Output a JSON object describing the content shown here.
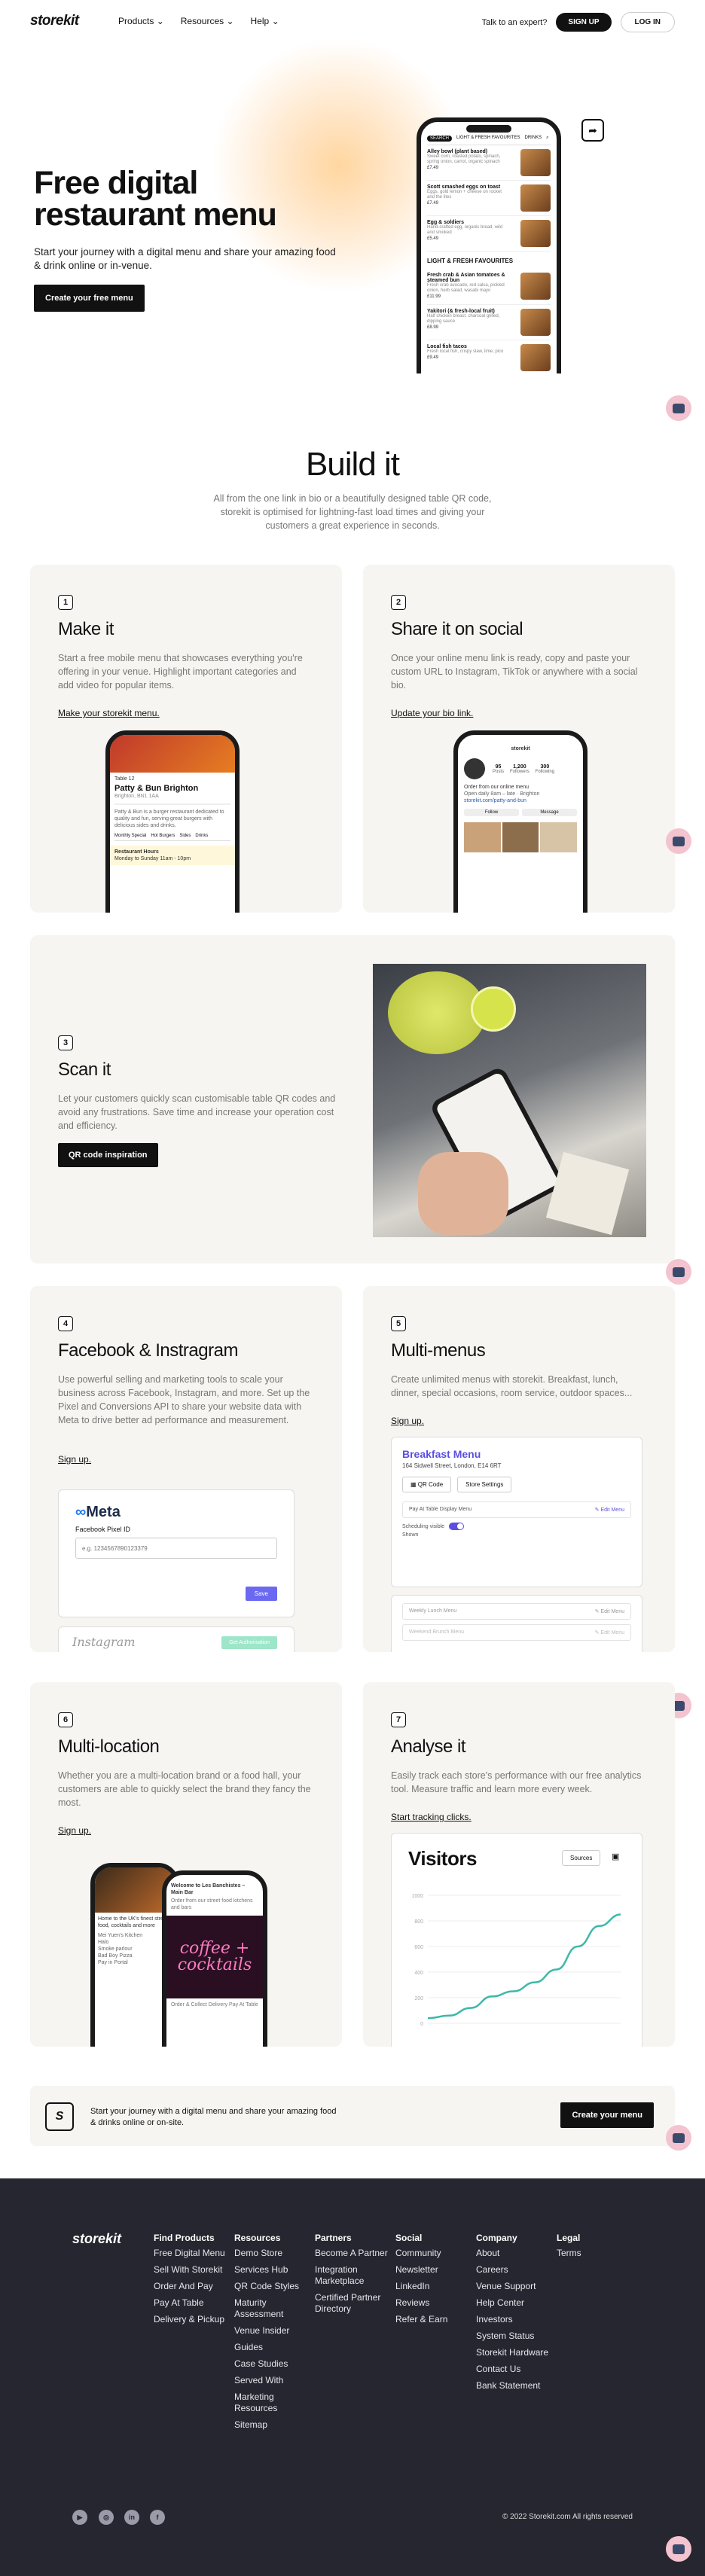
{
  "nav": {
    "logo": "storekit",
    "links": [
      "Products",
      "Resources",
      "Help"
    ],
    "expert": "Talk to an expert?",
    "signup": "SIGN UP",
    "login": "LOG IN"
  },
  "hero": {
    "title": "Free digital restaurant menu",
    "subtitle": "Start your journey with a digital menu and share your amazing food & drink online or in-venue.",
    "button": "Create your free menu",
    "phone": {
      "tabs": [
        "SEARCH",
        "LIGHT & FRESH FAVOURITES",
        "DRINKS"
      ],
      "items": [
        {
          "name": "Alley bowl (plant based)",
          "desc": "Sweet corn, roasted potato, spinach, spring onion, carrot, organic spinach",
          "price": "£7.49"
        },
        {
          "name": "Scott smashed eggs on toast",
          "desc": "Eggs, gold lemon + cheese on rocket and the lites",
          "price": "£7.49"
        },
        {
          "name": "Egg & soldiers",
          "desc": "Hand-crafted egg, organic bread, wild and smoked",
          "price": "£5.49"
        }
      ],
      "section": "LIGHT & FRESH FAVOURITES",
      "items2": [
        {
          "name": "Fresh crab & Asian tomatoes & steamed bun",
          "desc": "Fresh crab avocado, red salsa, pickled onion, herb salad, wasabi mayo",
          "price": "£11.99"
        },
        {
          "name": "Yakitori (& fresh-local fruit)",
          "desc": "Half chicken breast, charcoal grilled, dipping sauce",
          "price": "£8.99"
        },
        {
          "name": "Local fish tacos",
          "desc": "Fresh local fish, crispy slaw, lime, pico",
          "price": "£9.49"
        }
      ]
    }
  },
  "build": {
    "title": "Build it",
    "subtitle": "All from the one link in bio or a beautifully designed table QR code, storekit is optimised for lightning-fast load times and giving your customers a great experience in seconds."
  },
  "cards": [
    {
      "num": "1",
      "title": "Make it",
      "text": "Start a free mobile menu that showcases everything you're offering in your venue. Highlight important categories and add video for popular items.",
      "link": "Make your storekit menu.",
      "phone": {
        "table": "Table 12",
        "name": "Patty & Bun Brighton",
        "addr": "Brighton, BN1 1AA",
        "tabs": [
          "Monthly Special",
          "Hot Burgers",
          "Sides",
          "Drinks"
        ],
        "note": "Restaurant Hours",
        "note2": "Monday to Sunday 11am - 10pm"
      }
    },
    {
      "num": "2",
      "title": "Share it on social",
      "text": "Once your online menu link is ready, copy and paste your custom URL to Instagram, TikTok or anywhere with a social bio.",
      "link": "Update your bio link.",
      "phone": {
        "handle": "storekit",
        "stats": [
          [
            "95",
            "Posts"
          ],
          [
            "1,200",
            "Followers"
          ],
          [
            "300",
            "Following"
          ]
        ],
        "bio": "Order from our online menu"
      }
    },
    {
      "num": "3",
      "title": "Scan it",
      "text": "Let your customers quickly scan customisable table QR codes and avoid any frustrations. Save time and increase your operation cost and efficiency.",
      "button": "QR code inspiration"
    },
    {
      "num": "4",
      "title": "Facebook & Instragram",
      "text": "Use powerful selling and marketing tools to scale your business across Facebook, Instagram, and more. Set up the Pixel and Conversions API to share your website data with Meta to drive better ad performance and measurement.",
      "link": "Sign up.",
      "meta": {
        "logo": "Meta",
        "label": "Facebook Pixel ID",
        "placeholder": "e.g. 1234567890123379",
        "save": "Save",
        "ig": "Instagram",
        "ig_btn": "Get Authorisation"
      }
    },
    {
      "num": "5",
      "title": "Multi-menus",
      "text": "Create unlimited menus with storekit. Breakfast, lunch, dinner, special occasions, room service, outdoor spaces...",
      "link": "Sign up.",
      "menu": {
        "title": "Breakfast Menu",
        "addr": "164 Sidwell Street, London, E14 6RT",
        "btn1": "QR Code",
        "btn2": "Store Settings",
        "row1": "Pay At Table Display Menu",
        "edit": "Edit Menu",
        "sched": "Scheduling visible",
        "shown": "Shown",
        "row2": "Weekly Lunch Menu",
        "row3": "Weekend Brunch Menu"
      }
    },
    {
      "num": "6",
      "title": "Multi-location",
      "text": "Whether you are a multi-location brand or a food hall, your customers are able to quickly select the brand they fancy the most.",
      "link": "Sign up.",
      "phone": {
        "back": "Welcome to Les Banchistes – Main Bar",
        "neon": "coffee + cocktails",
        "menu": "Order & Collect  Delivery  Pay At Table"
      }
    },
    {
      "num": "7",
      "title": "Analyse it",
      "text": "Easily track each store's performance with our free analytics tool. Measure traffic and learn more every week.",
      "link": "Start tracking clicks.",
      "analytics": {
        "title": "Visitors",
        "dropdown": "Sources",
        "yticks": [
          "1000",
          "800",
          "600",
          "400",
          "200",
          "0"
        ],
        "chart_data": {
          "type": "line",
          "series": [
            {
              "values": [
                40,
                60,
                120,
                210,
                250,
                320,
                420,
                600,
                760,
                850
              ]
            }
          ],
          "ylim": [
            0,
            1000
          ]
        }
      }
    }
  ],
  "cta": {
    "text": "Start your journey with a digital menu and share your amazing food & drinks online or on-site.",
    "button": "Create your menu"
  },
  "footer": {
    "logo": "storekit",
    "cols": [
      {
        "title": "Find Products",
        "items": [
          "Free Digital Menu",
          "Sell With Storekit",
          "Order And Pay",
          "Pay At Table",
          "Delivery & Pickup"
        ]
      },
      {
        "title": "Resources",
        "items": [
          "Demo Store",
          "Services Hub",
          "QR Code Styles",
          "Maturity Assessment",
          "Venue Insider",
          "Guides",
          "Case Studies",
          "Served With",
          "Marketing Resources",
          "Sitemap"
        ]
      },
      {
        "title": "Partners",
        "items": [
          "Become A Partner",
          "Integration Marketplace",
          "Certified Partner Directory"
        ]
      },
      {
        "title": "Social",
        "items": [
          "Community",
          "Newsletter",
          "LinkedIn",
          "Reviews",
          "Refer & Earn"
        ]
      },
      {
        "title": "Company",
        "items": [
          "About",
          "Careers",
          "Venue Support",
          "Help Center",
          "Investors",
          "System Status",
          "Storekit Hardware",
          "Contact Us",
          "Bank Statement"
        ]
      },
      {
        "title": "Legal",
        "items": [
          "Terms"
        ]
      }
    ],
    "copyright": "© 2022 Storekit.com All rights reserved"
  }
}
